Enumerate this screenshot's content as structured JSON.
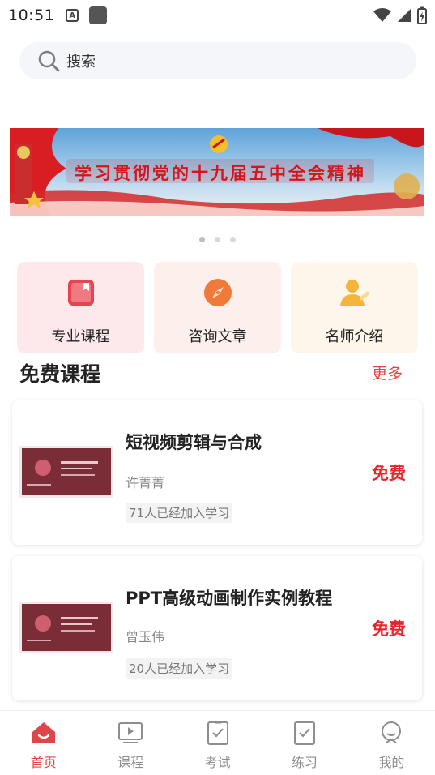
{
  "status_bar": {
    "time": "10:51"
  },
  "search": {
    "placeholder": "搜索"
  },
  "banner": {
    "text": "学习贯彻党的十九届五中全会精神",
    "total_slides": 3,
    "active_slide": 1
  },
  "categories": [
    {
      "label": "专业课程",
      "icon": "book-icon",
      "bg": "#fde9ec",
      "color": "#e8434f"
    },
    {
      "label": "咨询文章",
      "icon": "compass-icon",
      "bg": "#fdf0ec",
      "color": "#f07a3a"
    },
    {
      "label": "名师介绍",
      "icon": "teacher-icon",
      "bg": "#fdf6ea",
      "color": "#f5b53b"
    }
  ],
  "section": {
    "title": "免费课程",
    "more": "更多"
  },
  "courses": [
    {
      "title": "短视频剪辑与合成",
      "teacher": "许菁菁",
      "count": "71人已经加入学习",
      "price": "免费"
    },
    {
      "title": "PPT高级动画制作实例教程",
      "teacher": "曾玉伟",
      "count": "20人已经加入学习",
      "price": "免费"
    }
  ],
  "nav": [
    {
      "label": "首页",
      "icon": "home-icon",
      "active": true
    },
    {
      "label": "课程",
      "icon": "video-icon",
      "active": false
    },
    {
      "label": "考试",
      "icon": "exam-icon",
      "active": false
    },
    {
      "label": "练习",
      "icon": "practice-icon",
      "active": false
    },
    {
      "label": "我的",
      "icon": "profile-icon",
      "active": false
    }
  ],
  "colors": {
    "accent": "#e0454a",
    "price": "#e5262c"
  }
}
